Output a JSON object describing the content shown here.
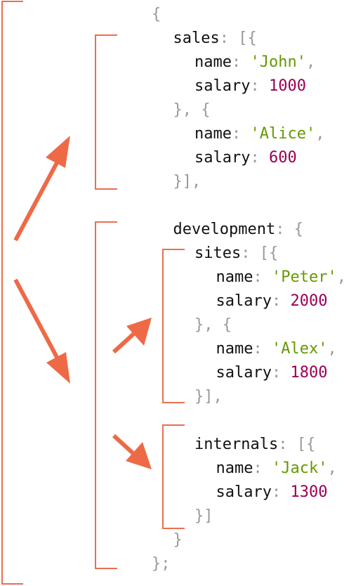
{
  "code": {
    "lines": [
      {
        "indent": 0,
        "tokens": [
          {
            "t": "p",
            "v": "{"
          }
        ]
      },
      {
        "indent": 1,
        "tokens": [
          {
            "t": "k",
            "v": "sales"
          },
          {
            "t": "p",
            "v": ": [{"
          }
        ]
      },
      {
        "indent": 2,
        "tokens": [
          {
            "t": "k",
            "v": "name"
          },
          {
            "t": "p",
            "v": ": "
          },
          {
            "t": "s",
            "v": "'John'"
          },
          {
            "t": "p",
            "v": ","
          }
        ]
      },
      {
        "indent": 2,
        "tokens": [
          {
            "t": "k",
            "v": "salary"
          },
          {
            "t": "p",
            "v": ": "
          },
          {
            "t": "n",
            "v": "1000"
          }
        ]
      },
      {
        "indent": 1,
        "tokens": [
          {
            "t": "p",
            "v": "}, {"
          }
        ]
      },
      {
        "indent": 2,
        "tokens": [
          {
            "t": "k",
            "v": "name"
          },
          {
            "t": "p",
            "v": ": "
          },
          {
            "t": "s",
            "v": "'Alice'"
          },
          {
            "t": "p",
            "v": ","
          }
        ]
      },
      {
        "indent": 2,
        "tokens": [
          {
            "t": "k",
            "v": "salary"
          },
          {
            "t": "p",
            "v": ": "
          },
          {
            "t": "n",
            "v": "600"
          }
        ]
      },
      {
        "indent": 1,
        "tokens": [
          {
            "t": "p",
            "v": "}],"
          }
        ]
      },
      {
        "indent": 0,
        "tokens": []
      },
      {
        "indent": 1,
        "tokens": [
          {
            "t": "k",
            "v": "development"
          },
          {
            "t": "p",
            "v": ": {"
          }
        ]
      },
      {
        "indent": 2,
        "tokens": [
          {
            "t": "k",
            "v": "sites"
          },
          {
            "t": "p",
            "v": ": [{"
          }
        ]
      },
      {
        "indent": 3,
        "tokens": [
          {
            "t": "k",
            "v": "name"
          },
          {
            "t": "p",
            "v": ": "
          },
          {
            "t": "s",
            "v": "'Peter'"
          },
          {
            "t": "p",
            "v": ","
          }
        ]
      },
      {
        "indent": 3,
        "tokens": [
          {
            "t": "k",
            "v": "salary"
          },
          {
            "t": "p",
            "v": ": "
          },
          {
            "t": "n",
            "v": "2000"
          }
        ]
      },
      {
        "indent": 2,
        "tokens": [
          {
            "t": "p",
            "v": "}, {"
          }
        ]
      },
      {
        "indent": 3,
        "tokens": [
          {
            "t": "k",
            "v": "name"
          },
          {
            "t": "p",
            "v": ": "
          },
          {
            "t": "s",
            "v": "'Alex'"
          },
          {
            "t": "p",
            "v": ","
          }
        ]
      },
      {
        "indent": 3,
        "tokens": [
          {
            "t": "k",
            "v": "salary"
          },
          {
            "t": "p",
            "v": ": "
          },
          {
            "t": "n",
            "v": "1800"
          }
        ]
      },
      {
        "indent": 2,
        "tokens": [
          {
            "t": "p",
            "v": "}],"
          }
        ]
      },
      {
        "indent": 0,
        "tokens": []
      },
      {
        "indent": 2,
        "tokens": [
          {
            "t": "k",
            "v": "internals"
          },
          {
            "t": "p",
            "v": ": [{"
          }
        ]
      },
      {
        "indent": 3,
        "tokens": [
          {
            "t": "k",
            "v": "name"
          },
          {
            "t": "p",
            "v": ": "
          },
          {
            "t": "s",
            "v": "'Jack'"
          },
          {
            "t": "p",
            "v": ","
          }
        ]
      },
      {
        "indent": 3,
        "tokens": [
          {
            "t": "k",
            "v": "salary"
          },
          {
            "t": "p",
            "v": ": "
          },
          {
            "t": "n",
            "v": "1300"
          }
        ]
      },
      {
        "indent": 2,
        "tokens": [
          {
            "t": "p",
            "v": "}]"
          }
        ]
      },
      {
        "indent": 1,
        "tokens": [
          {
            "t": "p",
            "v": "}"
          }
        ]
      },
      {
        "indent": 0,
        "tokens": [
          {
            "t": "p",
            "v": "};"
          }
        ]
      }
    ]
  },
  "colors": {
    "accent": "#ee6a47",
    "bracket": "#e8704f",
    "key": "#111111",
    "punctuation": "#999999",
    "string": "#669900",
    "number": "#990055"
  }
}
